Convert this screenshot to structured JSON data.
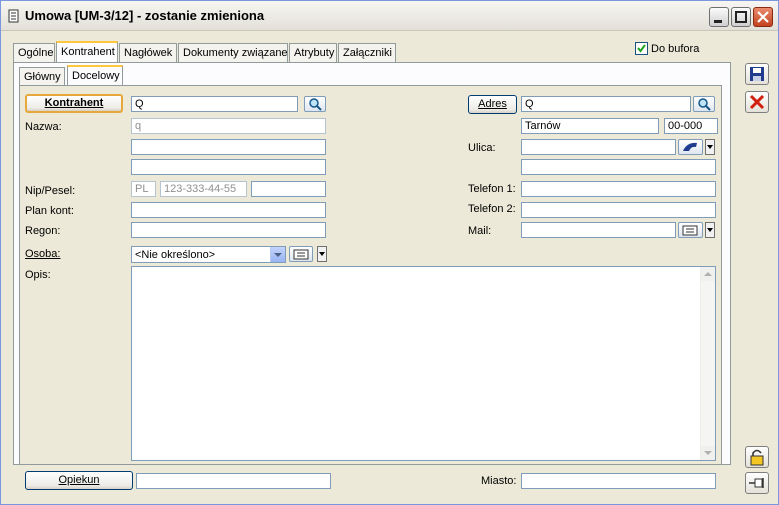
{
  "window": {
    "title": "Umowa [UM-3/12] - zostanie zmieniona"
  },
  "tabs": [
    "Ogólne",
    "Kontrahent",
    "Nagłówek",
    "Dokumenty związane",
    "Atrybuty",
    "Załączniki"
  ],
  "do_bufora": {
    "label": "Do bufora",
    "checked": true
  },
  "subtabs": [
    "Główny",
    "Docelowy"
  ],
  "left": {
    "kontrahent_button": "Kontrahent",
    "kontrahent_value": "Q",
    "nazwa_label": "Nazwa:",
    "nazwa_line1": "q",
    "nazwa_line2": "",
    "nazwa_line3": "",
    "nip_label": "Nip/Pesel:",
    "nip_prefix": "PL",
    "nip_value": "123-333-44-55",
    "nip_extra": "",
    "plan_label": "Plan kont:",
    "plan_value": "",
    "regon_label": "Regon:",
    "regon_value": "",
    "osoba_label": "Osoba:",
    "osoba_value": "<Nie określono>",
    "opis_label": "Opis:",
    "opis_value": ""
  },
  "right": {
    "adres_button": "Adres",
    "adres_value": "Q",
    "miasto_value": "Tarnów",
    "kod_value": "00-000",
    "ulica_label": "Ulica:",
    "ulica_value": "",
    "ulica_line2": "",
    "telefon1_label": "Telefon 1:",
    "telefon1_value": "",
    "telefon2_label": "Telefon 2:",
    "telefon2_value": "",
    "mail_label": "Mail:",
    "mail_value": ""
  },
  "bottom": {
    "opiekun_button": "Opiekun",
    "opiekun_value": "",
    "miasto_label": "Miasto:",
    "miasto_value": ""
  },
  "colors": {
    "accent_tab": "#ffc83c",
    "save_icon": "#1f3c8f",
    "cancel_icon": "#d21f0f"
  }
}
